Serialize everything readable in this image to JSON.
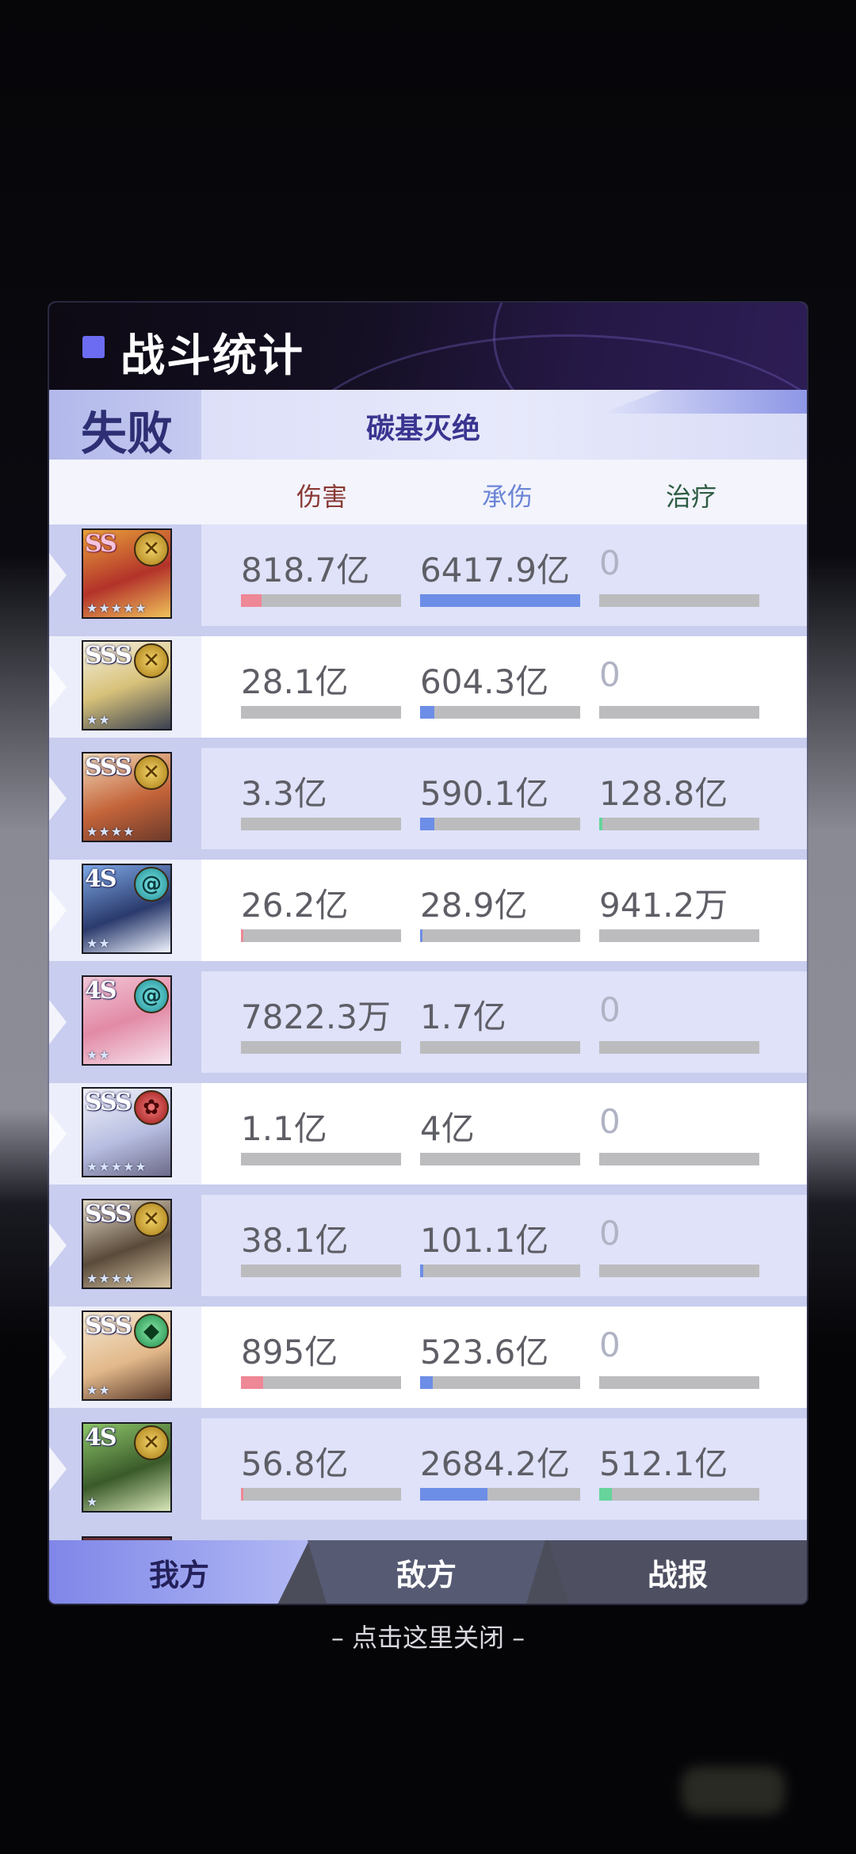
{
  "panel": {
    "title": "战斗统计",
    "result_label": "失败",
    "stage_name": "碳基灭绝"
  },
  "columns": {
    "damage": "伤害",
    "taken": "承伤",
    "heal": "治疗"
  },
  "colors": {
    "damage_bar": "#ee8796",
    "taken_bar": "#6d8ee6",
    "heal_bar": "#66d49b",
    "accent": "#6b6cf2"
  },
  "rows": [
    {
      "rarity": "SS",
      "element": "gold-cross-icon",
      "stars": "★★★★★",
      "damage": "818.7亿",
      "taken": "6417.9亿",
      "heal": "0",
      "damage_ratio": 0.13,
      "taken_ratio": 1.0,
      "heal_ratio": 0.0
    },
    {
      "rarity": "SSS",
      "element": "gold-cross-icon",
      "stars": "★★",
      "damage": "28.1亿",
      "taken": "604.3亿",
      "heal": "0",
      "damage_ratio": 0.0,
      "taken_ratio": 0.09,
      "heal_ratio": 0.0
    },
    {
      "rarity": "SSS",
      "element": "gold-cross-icon",
      "stars": "★★★★",
      "damage": "3.3亿",
      "taken": "590.1亿",
      "heal": "128.8亿",
      "damage_ratio": 0.0,
      "taken_ratio": 0.09,
      "heal_ratio": 0.02
    },
    {
      "rarity": "4S",
      "element": "teal-swirl-icon",
      "stars": "★★",
      "damage": "26.2亿",
      "taken": "28.9亿",
      "heal": "941.2万",
      "damage_ratio": 0.01,
      "taken_ratio": 0.01,
      "heal_ratio": 0.0
    },
    {
      "rarity": "4S",
      "element": "teal-swirl-icon",
      "stars": "★★",
      "damage": "7822.3万",
      "taken": "1.7亿",
      "heal": "0",
      "damage_ratio": 0.0,
      "taken_ratio": 0.0,
      "heal_ratio": 0.0
    },
    {
      "rarity": "SSS",
      "element": "red-flower-icon",
      "stars": "★★★★★",
      "damage": "1.1亿",
      "taken": "4亿",
      "heal": "0",
      "damage_ratio": 0.0,
      "taken_ratio": 0.0,
      "heal_ratio": 0.0
    },
    {
      "rarity": "SSS",
      "element": "gold-cross-icon",
      "stars": "★★★★",
      "damage": "38.1亿",
      "taken": "101.1亿",
      "heal": "0",
      "damage_ratio": 0.0,
      "taken_ratio": 0.02,
      "heal_ratio": 0.0
    },
    {
      "rarity": "SSS",
      "element": "green-gem-icon",
      "stars": "★★",
      "damage": "895亿",
      "taken": "523.6亿",
      "heal": "0",
      "damage_ratio": 0.14,
      "taken_ratio": 0.08,
      "heal_ratio": 0.0
    },
    {
      "rarity": "4S",
      "element": "gold-cross-icon",
      "stars": "★",
      "damage": "56.8亿",
      "taken": "2684.2亿",
      "heal": "512.1亿",
      "damage_ratio": 0.01,
      "taken_ratio": 0.42,
      "heal_ratio": 0.08
    }
  ],
  "tabs": {
    "ours": "我方",
    "enemy": "敌方",
    "report": "战报"
  },
  "close_hint": "– 点击这里关闭 –"
}
